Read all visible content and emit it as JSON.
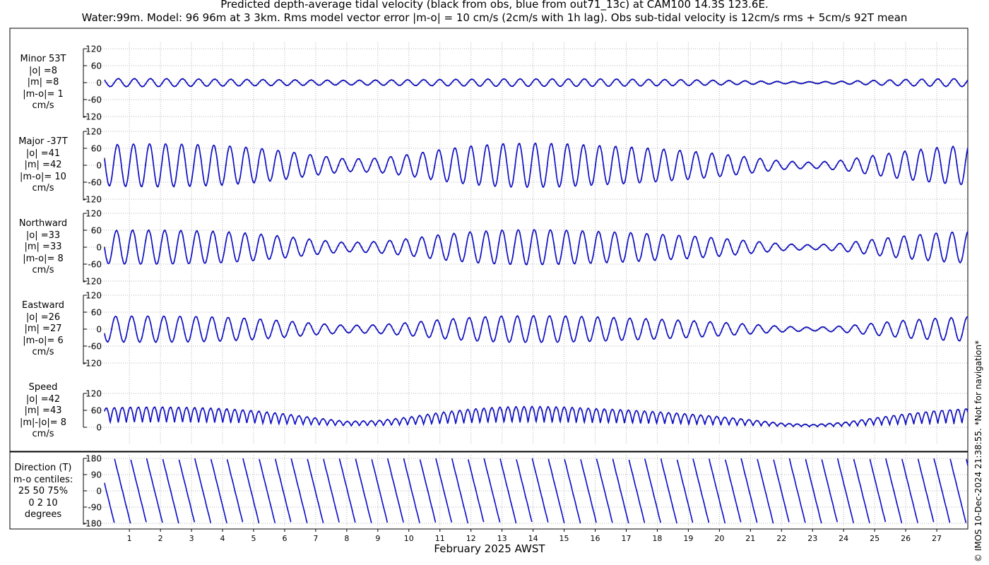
{
  "header": {
    "title": "Predicted depth-average tidal velocity (black from obs, blue from out71_13c) at CAM100 14.3S 123.6E.",
    "subtitle": "Water:99m. Model: 96 96m at 3 3km. Rms model vector error |m-o| = 10 cm/s (2cm/s with 1h lag). Obs sub-tidal velocity is 12cm/s rms + 5cm/s 92T mean"
  },
  "xaxis": {
    "label": "February 2025 AWST",
    "ticks": [
      "1",
      "2",
      "3",
      "4",
      "5",
      "6",
      "7",
      "8",
      "9",
      "10",
      "11",
      "12",
      "13",
      "14",
      "15",
      "16",
      "17",
      "18",
      "19",
      "20",
      "21",
      "22",
      "23",
      "24",
      "25",
      "26",
      "27"
    ]
  },
  "credit": "© IMOS 10-Dec-2024 21:38:55. *Not for navigation*",
  "colors": {
    "obs": "#000000",
    "model": "#1010d0",
    "grid": "#b4b4b4",
    "axis": "#000000"
  },
  "panels": [
    {
      "id": "minor",
      "label_lines": [
        "Minor 53T",
        "|o| =8",
        "|m| =8",
        "|m-o|= 1",
        "cm/s"
      ]
    },
    {
      "id": "major",
      "label_lines": [
        "Major -37T",
        "|o| =41",
        "|m| =42",
        "|m-o|= 10",
        "cm/s"
      ]
    },
    {
      "id": "north",
      "label_lines": [
        "Northward",
        "|o| =33",
        "|m| =33",
        "|m-o|= 8",
        "cm/s"
      ]
    },
    {
      "id": "east",
      "label_lines": [
        "Eastward",
        "|o| =26",
        "|m| =27",
        "|m-o|= 6",
        "cm/s"
      ]
    },
    {
      "id": "speed",
      "label_lines": [
        "Speed",
        "|o| =42",
        "|m| =43",
        "|m|-|o|= 8",
        "cm/s"
      ]
    },
    {
      "id": "direction",
      "label_lines": [
        "Direction (T)",
        "m-o centiles:",
        "25  50  75%",
        "0  2 10",
        "degrees"
      ]
    }
  ],
  "chart_data": {
    "type": "line",
    "x_unit": "days of February 2025 (AWST)",
    "x_range": [
      0.2,
      28.0
    ],
    "semidiurnal_period_hours": 12.42,
    "series": [
      {
        "name": "obs",
        "color": "#000000"
      },
      {
        "name": "model",
        "color": "#1010d0"
      }
    ],
    "envelope_days": [
      0.2,
      1,
      2,
      3,
      4,
      5,
      6,
      7,
      8,
      9,
      10,
      11,
      12,
      13,
      14,
      15,
      16,
      17,
      18,
      19,
      20,
      21,
      22,
      23,
      24,
      25,
      26,
      27,
      28
    ],
    "panels": [
      {
        "id": "minor",
        "ylim": [
          -120,
          120
        ],
        "yticks": [
          120,
          60,
          0,
          -60,
          -120
        ],
        "amplitude": [
          14,
          14,
          14,
          13,
          12,
          11,
          10,
          9,
          8,
          9,
          10,
          11,
          12,
          13,
          13,
          13,
          13,
          12,
          11,
          10,
          8,
          6,
          4,
          3,
          5,
          8,
          11,
          13,
          14
        ]
      },
      {
        "id": "major",
        "ylim": [
          -120,
          120
        ],
        "yticks": [
          120,
          60,
          0,
          -60,
          -120
        ],
        "amplitude": [
          72,
          75,
          76,
          74,
          70,
          62,
          50,
          35,
          22,
          25,
          38,
          55,
          68,
          76,
          78,
          76,
          70,
          65,
          58,
          50,
          40,
          28,
          15,
          10,
          18,
          35,
          50,
          62,
          70
        ]
      },
      {
        "id": "north",
        "ylim": [
          -120,
          120
        ],
        "yticks": [
          120,
          60,
          0,
          -60,
          -120
        ],
        "amplitude": [
          58,
          60,
          60,
          58,
          55,
          48,
          38,
          26,
          16,
          20,
          30,
          44,
          54,
          60,
          62,
          60,
          56,
          52,
          46,
          40,
          32,
          22,
          12,
          8,
          14,
          28,
          40,
          50,
          56
        ]
      },
      {
        "id": "east",
        "ylim": [
          -120,
          120
        ],
        "yticks": [
          120,
          60,
          0,
          -60,
          -120
        ],
        "amplitude": [
          45,
          46,
          46,
          45,
          42,
          37,
          29,
          20,
          13,
          15,
          23,
          33,
          41,
          46,
          47,
          46,
          43,
          39,
          35,
          30,
          24,
          17,
          10,
          6,
          11,
          21,
          31,
          38,
          43
        ]
      },
      {
        "id": "speed",
        "ylim": [
          0,
          120
        ],
        "yticks": [
          120,
          60,
          0
        ],
        "amplitude": [
          72,
          75,
          76,
          74,
          70,
          62,
          50,
          35,
          22,
          25,
          38,
          55,
          68,
          76,
          78,
          76,
          70,
          65,
          58,
          50,
          40,
          28,
          15,
          10,
          18,
          35,
          50,
          62,
          70
        ]
      },
      {
        "id": "direction",
        "ylim": [
          -180,
          180
        ],
        "yticks": [
          180,
          90,
          0,
          -90,
          -180
        ]
      }
    ]
  }
}
